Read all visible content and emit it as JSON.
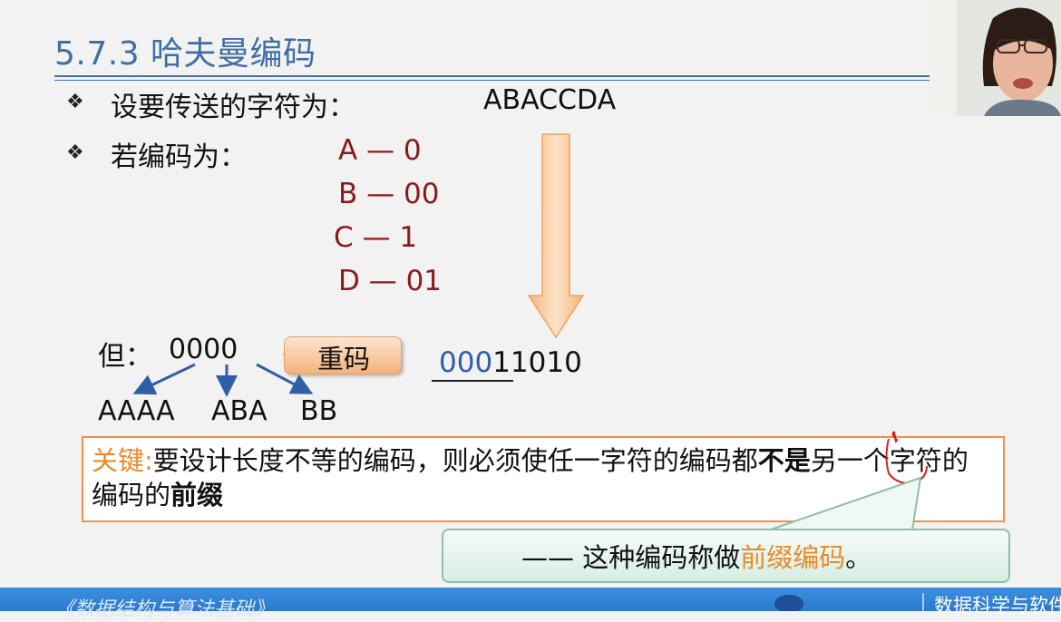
{
  "slide": {
    "title": "5.7.3 哈夫曼编码",
    "bullet_symbol": "❖",
    "line1_label": "设要传送的字符为：",
    "line1_value": "ABACCDA",
    "line2_label": "若编码为：",
    "codes": [
      "A — 0",
      "B — 00",
      "C  — 1",
      "D — 01"
    ],
    "but_label": "但：",
    "but_value": "0000",
    "decodings": [
      "AAAA",
      "ABA",
      "BB"
    ],
    "dup_code_label": "重码",
    "encoded_prefix": "000",
    "encoded_rest": "11010",
    "key_label": "关键:",
    "key_text_1": "要设计长度不等的编码，则必须使任一字符的编码都",
    "key_bold_1": "不是",
    "key_text_2": "另一个字符的编码的",
    "key_bold_2": "前缀",
    "callout_dash": "——",
    "callout_text": " 这种编码称做",
    "callout_term": "前缀编码",
    "callout_end": "。"
  },
  "footer": {
    "left_text": "《数据结构与算法基础》",
    "right_text": "数据科学与软件"
  },
  "colors": {
    "title": "#3f6fa6",
    "code": "#8b1a1a",
    "accent_orange": "#e98a2c",
    "footer_blue": "#2d79cc"
  }
}
